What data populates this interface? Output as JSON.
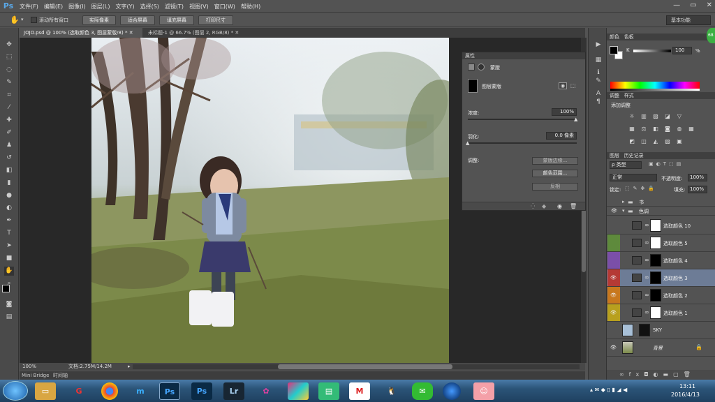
{
  "menubar": {
    "logo": "Ps",
    "items": [
      "文件(F)",
      "编辑(E)",
      "图像(I)",
      "图层(L)",
      "文字(Y)",
      "选择(S)",
      "滤镜(T)",
      "视图(V)",
      "窗口(W)",
      "帮助(H)"
    ],
    "window_controls": [
      "—",
      "▭",
      "✕"
    ]
  },
  "options": {
    "scroll_all_label": "滚动所有窗口",
    "buttons": [
      "实际像素",
      "适合屏幕",
      "填充屏幕",
      "打印尺寸"
    ],
    "workspace": "基本功能"
  },
  "tabs": [
    {
      "label": "JOJO.psd @ 100% (选取颜色 3, 图层蒙版/8) *"
    },
    {
      "label": "未标题-1 @ 66.7% (图层 2, RGB/8) *"
    }
  ],
  "status": {
    "zoom": "100%",
    "doc": "文档:2.75M/14.2M",
    "bridge": "Mini Bridge",
    "timeline": "时间轴"
  },
  "properties": {
    "title": "属性",
    "type": "蒙版",
    "mask_label": "图层蒙版",
    "density_label": "浓度:",
    "density_value": "100%",
    "density": 1.0,
    "feather_label": "羽化:",
    "feather_value": "0.0 像素",
    "refine_label": "调整:",
    "btn_edge": "蒙版边缘...",
    "btn_color_range": "颜色范围...",
    "btn_invert": "反相"
  },
  "color_panel": {
    "tabs": [
      "颜色",
      "色板"
    ],
    "channel": "K",
    "value": "100",
    "unit": "%",
    "foreground": "#000000",
    "background": "#ffffff"
  },
  "adjustments": {
    "tabs": [
      "调整",
      "样式"
    ],
    "title": "添加调整"
  },
  "layers_panel": {
    "tabs": [
      "图层",
      "历史记录"
    ],
    "filter": "ρ 类型",
    "blend_mode": "正常",
    "opacity_label": "不透明度:",
    "opacity": "100%",
    "lock_label": "锁定:",
    "fill_label": "填充:",
    "fill": "100%",
    "groups": [
      {
        "name": "书",
        "expanded": false
      },
      {
        "name": "色调",
        "expanded": true
      }
    ],
    "layers": [
      {
        "name": "选取颜色 10",
        "color": "#535353",
        "visible": false,
        "mask": "#ffffff",
        "selected": false
      },
      {
        "name": "选取颜色 5",
        "color": "#5e8a3c",
        "visible": false,
        "mask": "#ffffff",
        "selected": false
      },
      {
        "name": "选取颜色 4",
        "color": "#7b4fa8",
        "visible": false,
        "mask": "#000000",
        "selected": false
      },
      {
        "name": "选取颜色 3",
        "color": "#b53a35",
        "visible": true,
        "mask": "#000000",
        "selected": true
      },
      {
        "name": "选取颜色 2",
        "color": "#c8781e",
        "visible": true,
        "mask": "#000000",
        "selected": false
      },
      {
        "name": "选取颜色 1",
        "color": "#b8a01e",
        "visible": true,
        "mask": "#ffffff",
        "selected": false
      },
      {
        "name": "SKY",
        "color": "#535353",
        "visible": false,
        "mask": "#111111",
        "selected": false
      },
      {
        "name": "背景",
        "color": "#535353",
        "visible": true,
        "mask": "",
        "selected": false
      }
    ]
  },
  "taskbar": {
    "apps": [
      "Ps",
      "Ps",
      "Lr",
      "M"
    ],
    "time": "13:11",
    "date": "2016/4/13"
  }
}
